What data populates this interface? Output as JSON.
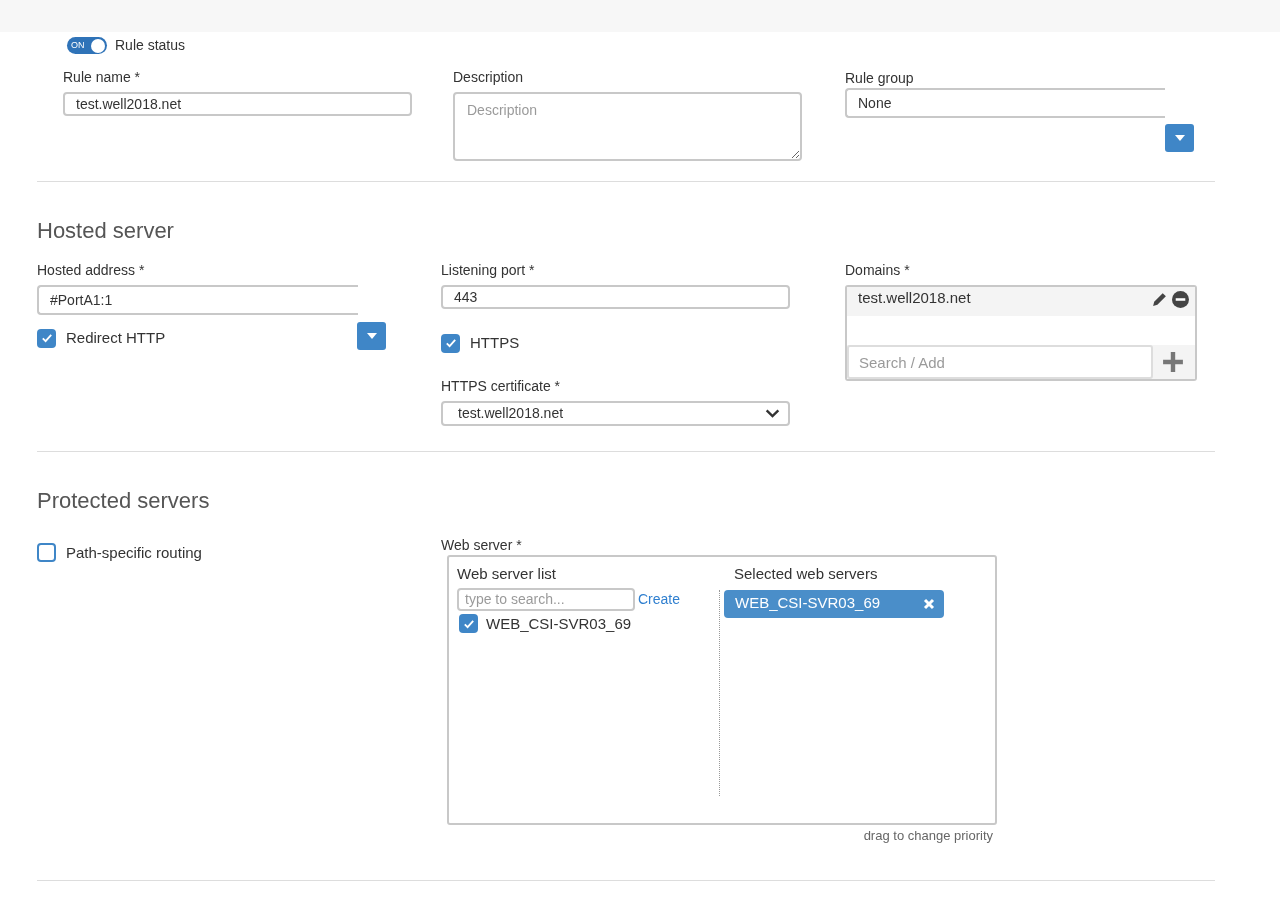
{
  "rule_status": {
    "toggle_label": "ON",
    "on": true,
    "label": "Rule status"
  },
  "rule_name": {
    "label": "Rule name *",
    "value": "test.well2018.net"
  },
  "description": {
    "label": "Description",
    "placeholder": "Description"
  },
  "rule_group": {
    "label": "Rule group",
    "value": "None"
  },
  "hosted_server": {
    "heading": "Hosted server",
    "hosted_address": {
      "label": "Hosted address *",
      "value": "#PortA1:1"
    },
    "redirect_http": {
      "label": "Redirect HTTP",
      "checked": true
    },
    "listening_port": {
      "label": "Listening port *",
      "value": "443"
    },
    "https": {
      "label": "HTTPS",
      "checked": true
    },
    "https_certificate": {
      "label": "HTTPS certificate *",
      "value": "test.well2018.net"
    },
    "domains": {
      "label": "Domains *",
      "items": [
        "test.well2018.net"
      ],
      "placeholder": "Search / Add"
    }
  },
  "protected_servers": {
    "heading": "Protected servers",
    "path_specific_routing": {
      "label": "Path-specific routing",
      "checked": false
    },
    "web_server": {
      "label": "Web server *",
      "list_title": "Web server list",
      "search_placeholder": "type to search...",
      "create_link": "Create",
      "list_items": [
        {
          "label": "WEB_CSI-SVR03_69",
          "checked": true
        }
      ],
      "selected_title": "Selected web servers",
      "selected_items": [
        "WEB_CSI-SVR03_69"
      ],
      "hint": "drag to change priority"
    }
  }
}
